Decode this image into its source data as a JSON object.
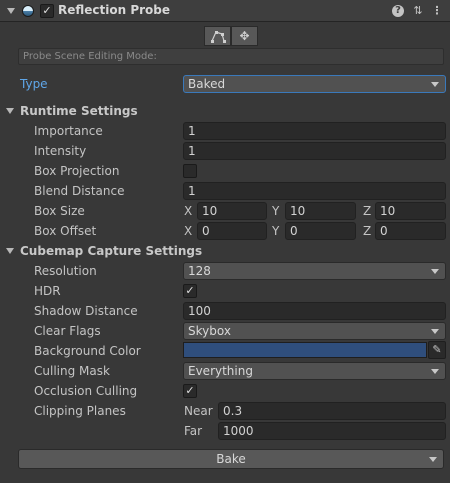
{
  "header": {
    "title": "Reflection Probe",
    "enabled_check": "✓",
    "icons": [
      "probe-icon",
      "help-icon",
      "settings-sliders-icon",
      "more-options-icon"
    ]
  },
  "edit_mode": {
    "placeholder": "Probe Scene Editing Mode:",
    "buttons": [
      "edit-bounds-icon",
      "edit-origin-icon"
    ]
  },
  "type": {
    "label": "Type",
    "value": "Baked",
    "accent": "#5fa6e8"
  },
  "runtime": {
    "title": "Runtime Settings",
    "importance": {
      "label": "Importance",
      "value": "1"
    },
    "intensity": {
      "label": "Intensity",
      "value": "1"
    },
    "box_projection": {
      "label": "Box Projection",
      "checked": false
    },
    "blend_distance": {
      "label": "Blend Distance",
      "value": "1"
    },
    "box_size": {
      "label": "Box Size",
      "x_label": "X",
      "x": "10",
      "y_label": "Y",
      "y": "10",
      "z_label": "Z",
      "z": "10"
    },
    "box_offset": {
      "label": "Box Offset",
      "x_label": "X",
      "x": "0",
      "y_label": "Y",
      "y": "0",
      "z_label": "Z",
      "z": "0"
    }
  },
  "cubemap": {
    "title": "Cubemap Capture Settings",
    "resolution": {
      "label": "Resolution",
      "value": "128"
    },
    "hdr": {
      "label": "HDR",
      "check": "✓"
    },
    "shadow_distance": {
      "label": "Shadow Distance",
      "value": "100"
    },
    "clear_flags": {
      "label": "Clear Flags",
      "value": "Skybox"
    },
    "background_color": {
      "label": "Background Color",
      "color": "#2f4e7c"
    },
    "culling_mask": {
      "label": "Culling Mask",
      "value": "Everything"
    },
    "occlusion_culling": {
      "label": "Occlusion Culling",
      "check": "✓"
    },
    "clipping_planes": {
      "label": "Clipping Planes",
      "near_label": "Near",
      "near": "0.3",
      "far_label": "Far",
      "far": "1000"
    }
  },
  "bake_button": {
    "label": "Bake"
  }
}
